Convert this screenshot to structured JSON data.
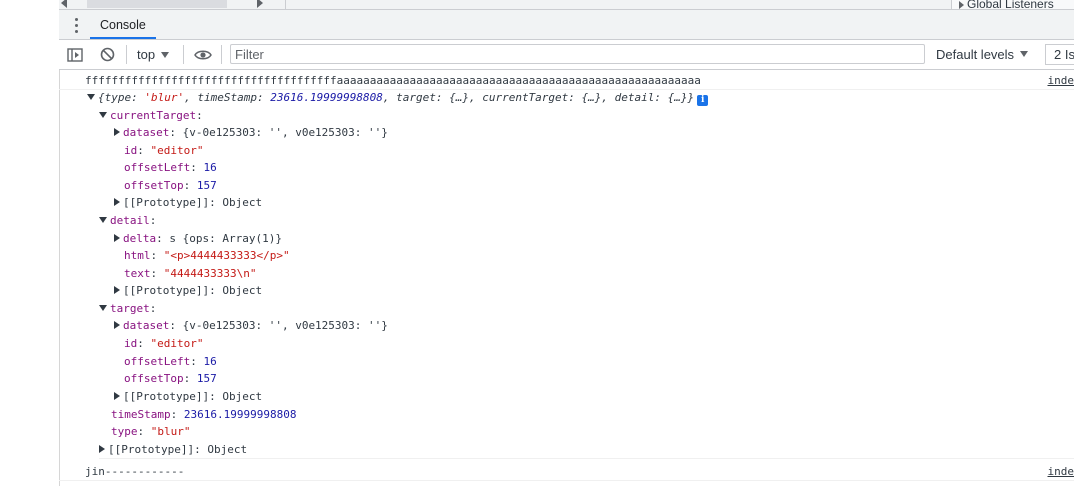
{
  "top_strip": {
    "right_label": "Global Listeners"
  },
  "tabs": [
    {
      "label": "Console"
    }
  ],
  "toolbar": {
    "context": "top",
    "filter_placeholder": "Filter",
    "levels": "Default levels",
    "issues": "2 Is"
  },
  "log": {
    "line1": "ffffffffffffffffffffffffffffffffffffffaaaaaaaaaaaaaaaaaaaaaaaaaaaaaaaaaaaaaaaaaaaaaaaaaaaaaaa",
    "line1_source": "inde",
    "summary": {
      "open": "{",
      "type_key": "type",
      "type_val": "'blur'",
      "ts_key": "timeStamp",
      "ts_val": "23616.19999998808",
      "target_key": "target",
      "target_val": "{…}",
      "ct_key": "currentTarget",
      "ct_val": "{…}",
      "detail_key": "detail",
      "detail_val": "{…}",
      "close": "}",
      "info_glyph": "i"
    },
    "currentTarget": {
      "key": "currentTarget",
      "dataset_key": "dataset",
      "dataset_val": "{v-0e125303: '', v0e125303: ''}",
      "id_key": "id",
      "id_val": "\"editor\"",
      "offsetLeft_key": "offsetLeft",
      "offsetLeft_val": "16",
      "offsetTop_key": "offsetTop",
      "offsetTop_val": "157",
      "proto": "[[Prototype]]: Object"
    },
    "detail": {
      "key": "detail",
      "delta_key": "delta",
      "delta_val": "s {ops: Array(1)}",
      "html_key": "html",
      "html_val": "\"<p>4444433333</p>\"",
      "text_key": "text",
      "text_val": "\"4444433333\\n\"",
      "proto": "[[Prototype]]: Object"
    },
    "target": {
      "key": "target",
      "dataset_key": "dataset",
      "dataset_val": "{v-0e125303: '', v0e125303: ''}",
      "id_key": "id",
      "id_val": "\"editor\"",
      "offsetLeft_key": "offsetLeft",
      "offsetLeft_val": "16",
      "offsetTop_key": "offsetTop",
      "offsetTop_val": "157",
      "proto": "[[Prototype]]: Object"
    },
    "timeStamp_key": "timeStamp",
    "timeStamp_val": "23616.19999998808",
    "type_key": "type",
    "type_val": "\"blur\"",
    "root_proto": "[[Prototype]]: Object",
    "last_line": "jin------------",
    "last_source": "inde"
  }
}
